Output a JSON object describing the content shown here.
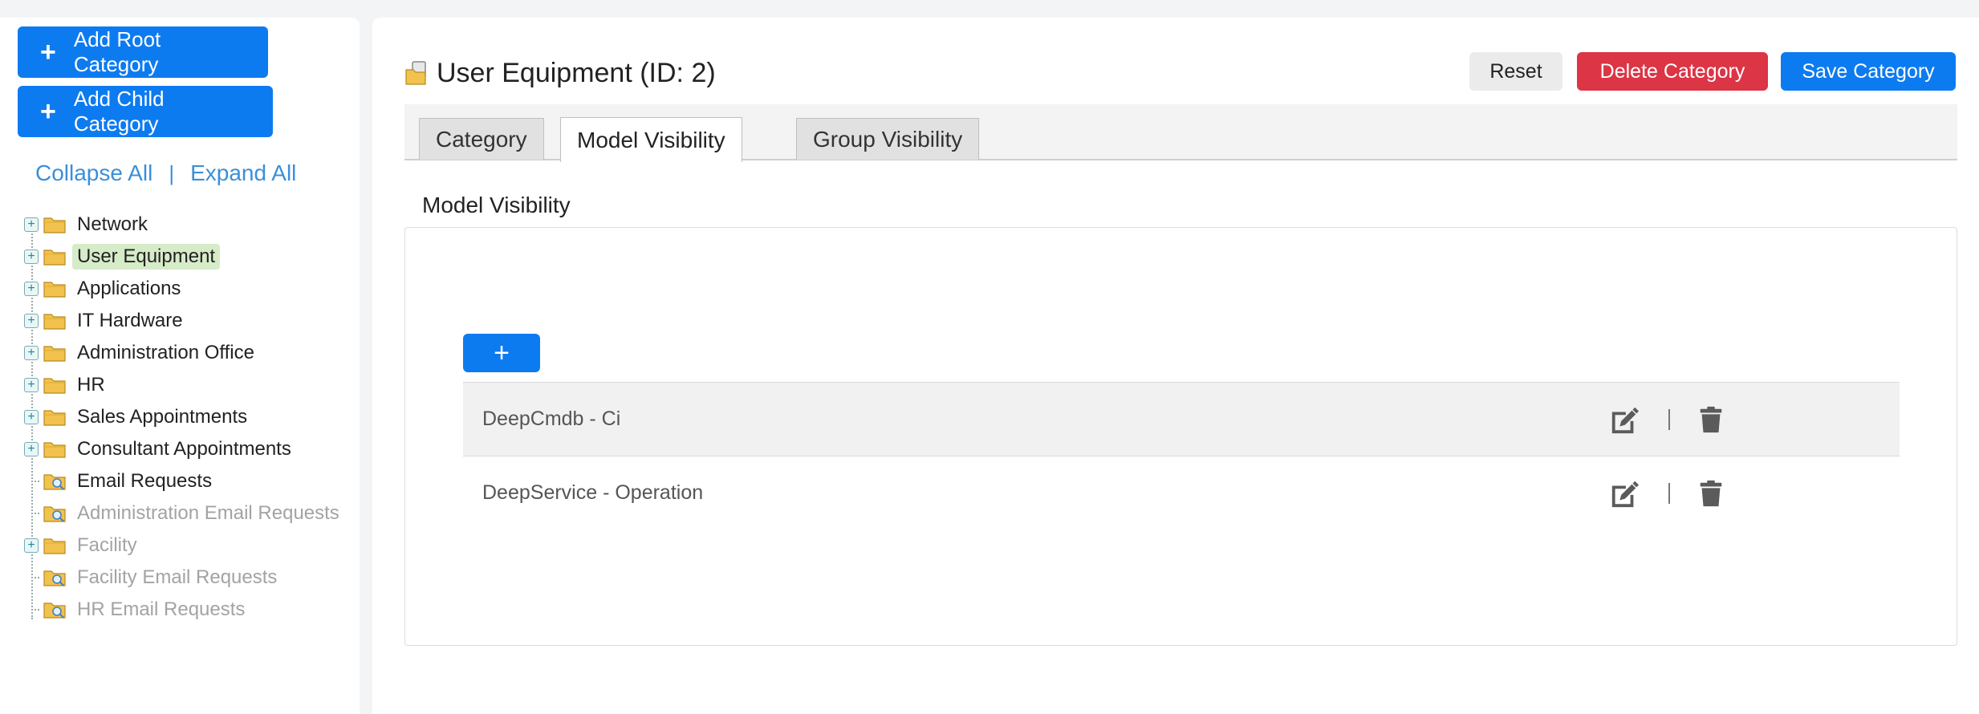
{
  "sidebar": {
    "add_root_label": "Add Root Category",
    "add_child_label": "Add Child Category",
    "collapse_all": "Collapse All",
    "separator": "|",
    "expand_all": "Expand All",
    "tree": [
      {
        "label": "Network",
        "expandable": true,
        "dim": false,
        "selected": false,
        "icon": "folder-icon"
      },
      {
        "label": "User Equipment",
        "expandable": true,
        "dim": false,
        "selected": true,
        "icon": "folder-icon"
      },
      {
        "label": "Applications",
        "expandable": true,
        "dim": false,
        "selected": false,
        "icon": "folder-icon"
      },
      {
        "label": "IT Hardware",
        "expandable": true,
        "dim": false,
        "selected": false,
        "icon": "folder-icon"
      },
      {
        "label": "Administration Office",
        "expandable": true,
        "dim": false,
        "selected": false,
        "icon": "folder-icon"
      },
      {
        "label": "HR",
        "expandable": true,
        "dim": false,
        "selected": false,
        "icon": "folder-icon"
      },
      {
        "label": "Sales Appointments",
        "expandable": true,
        "dim": false,
        "selected": false,
        "icon": "folder-icon"
      },
      {
        "label": "Consultant Appointments",
        "expandable": true,
        "dim": false,
        "selected": false,
        "icon": "folder-icon"
      },
      {
        "label": "Email Requests",
        "expandable": false,
        "dim": false,
        "selected": false,
        "icon": "folder-search-icon"
      },
      {
        "label": "Administration Email Requests",
        "expandable": false,
        "dim": true,
        "selected": false,
        "icon": "folder-search-icon"
      },
      {
        "label": "Facility",
        "expandable": true,
        "dim": true,
        "selected": false,
        "icon": "folder-icon"
      },
      {
        "label": "Facility Email Requests",
        "expandable": false,
        "dim": true,
        "selected": false,
        "icon": "folder-search-icon"
      },
      {
        "label": "HR Email Requests",
        "expandable": false,
        "dim": true,
        "selected": false,
        "icon": "folder-search-icon"
      }
    ]
  },
  "header": {
    "title": "User Equipment (ID: 2)",
    "reset_label": "Reset",
    "delete_label": "Delete Category",
    "save_label": "Save Category"
  },
  "tabs": [
    {
      "label": "Category",
      "active": false
    },
    {
      "label": "Model Visibility",
      "active": true
    },
    {
      "label": "Group Visibility",
      "active": false
    }
  ],
  "model_visibility": {
    "section_title": "Model Visibility",
    "add_label": "+",
    "rows": [
      {
        "label": "DeepCmdb - Ci"
      },
      {
        "label": "DeepService - Operation"
      }
    ],
    "action_separator": "|"
  },
  "colors": {
    "primary": "#0d7bf0",
    "danger": "#dc3545",
    "selected_node": "#d6ebc8",
    "link": "#3b8fd9"
  }
}
